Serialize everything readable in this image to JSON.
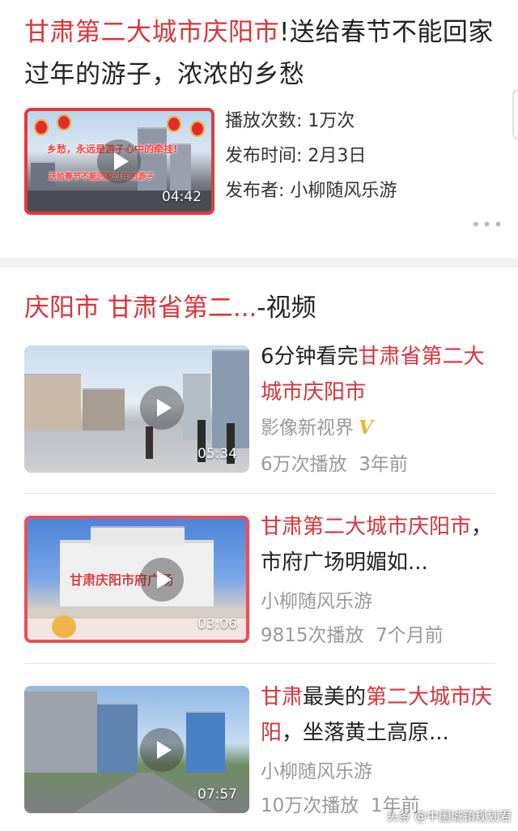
{
  "video_card": {
    "title_highlight": "甘肃第二大城市庆阳市",
    "title_rest": "!送给春节不能回家过年的游子，浓浓的乡愁",
    "duration": "04:42",
    "thumb_caption_top": "乡愁，永远是游子心中的牵挂!",
    "thumb_caption_bottom": "送给春节不能回家过年的游子",
    "play_count": "播放次数: 1万次",
    "publish_time": "发布时间: 2月3日",
    "publisher": "发布者: 小柳随风乐游",
    "more": "•••"
  },
  "related": {
    "heading_highlight": "庆阳市 甘肃省第二...",
    "heading_rest": "-视频",
    "videos": [
      {
        "title_parts": [
          "6分钟看完",
          "甘肃省第二大城市庆阳市"
        ],
        "author": "影像新视界",
        "verified": "V",
        "plays": "6万次播放",
        "age": "3年前",
        "duration": "05:34"
      },
      {
        "title_parts": [
          "甘肃第二大城市庆阳市",
          "，市府广场明媚如..."
        ],
        "author": "小柳随风乐游",
        "plays": "9815次播放",
        "age": "7个月前",
        "duration": "03:06",
        "thumb_caption": "甘肃庆阳市府广场"
      },
      {
        "title_parts": [
          "甘肃",
          "最美的",
          "第二大城市庆阳",
          "，坐落黄土高原..."
        ],
        "author": "小柳随风乐游",
        "plays": "10万次播放",
        "age": "1年前",
        "duration": "07:57"
      }
    ]
  },
  "watermark": "头条 @中国城镇规划君",
  "colors": {
    "highlight": "#d9343a",
    "meta_gray": "#999999",
    "background": "#f2f2f2"
  }
}
